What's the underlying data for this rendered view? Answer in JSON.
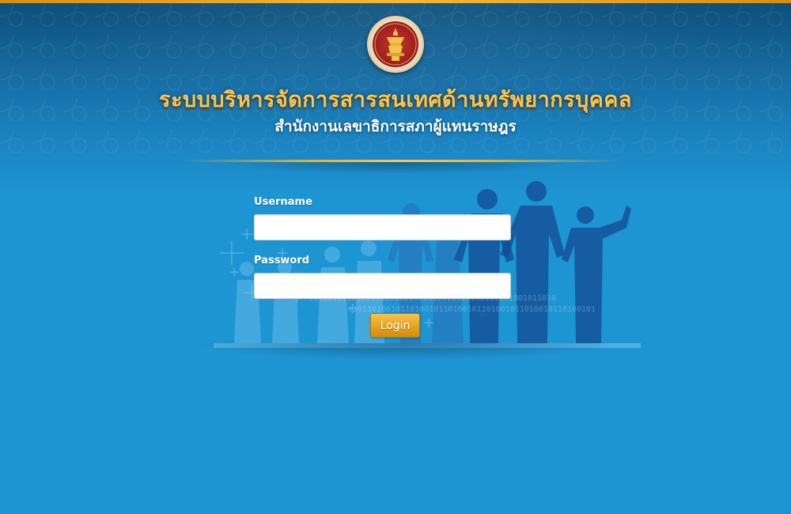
{
  "header": {
    "title": "ระบบบริหารจัดการสารสนเทศด้านทรัพยากรบุคคล",
    "subtitle": "สำนักงานเลขาธิการสภาผู้แทนราษฎร"
  },
  "login_form": {
    "username_label": "Username",
    "username_value": "",
    "password_label": "Password",
    "password_value": "",
    "login_button_label": "Login"
  },
  "decor": {
    "binary_text": "1010010110100101101001011010010110100101101001011010",
    "binary_text_2": "0101101001011010010110100101101001011010010110100101"
  },
  "colors": {
    "background": "#1e95d3",
    "header_dark": "#0d4f7c",
    "title_gold": "#f5c65a",
    "accent_orange": "#e6a21e"
  }
}
